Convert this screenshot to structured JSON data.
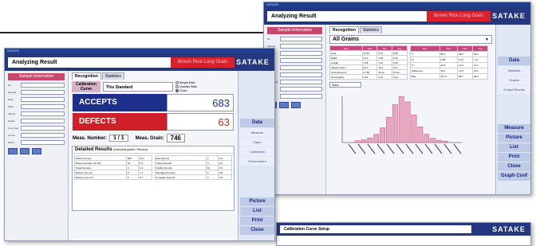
{
  "colors": {
    "header": "#24377f",
    "red": "#d8232a",
    "accepts": "#1d2f8a",
    "defects": "#cf1f2a",
    "pink": "#c9476a"
  },
  "win_back": {
    "titlebar": "SATAKE",
    "title": "Analyzing Result",
    "red_banner": "Brown Rice Long Grain",
    "brand": "SATAKE",
    "left_button": "Sample Information",
    "fields": [
      "No.",
      "Sample",
      "Date",
      "Place",
      "Variety",
      "Grade",
      "Crop Year",
      "Lot No.",
      "Memo"
    ],
    "tabs": [
      "Recognition",
      "Statistics"
    ],
    "combo": "All Grains",
    "table_left": {
      "headers": [
        "Item",
        "Max",
        "Min",
        "Avg"
      ],
      "rows": [
        [
          "Area",
          "12.45",
          "5.21",
          "8.95"
        ],
        [
          "Width",
          "3.10",
          "2.05",
          "2.63"
        ],
        [
          "Length",
          "7.85",
          "4.31",
          "6.42"
        ],
        [
          "Weight (Calc.)",
          "25.3",
          "10.4",
          "18.7"
        ],
        [
          "Circumference",
          "17.55",
          "11.02",
          "15.12"
        ],
        [
          "Chromaticity",
          "0.54",
          "0.31",
          "0.44"
        ]
      ]
    },
    "table_right": {
      "headers": [
        "Item",
        "Max",
        "Min",
        "Avg"
      ],
      "rows": [
        [
          "L*",
          "58.1",
          "48.2",
          "53.6"
        ],
        [
          "a*",
          "2.85",
          "0.12",
          "1.47"
        ],
        [
          "b*",
          "20.3",
          "14.5",
          "17.2"
        ],
        [
          "Whiteness",
          "18.2",
          "12.6",
          "15.4"
        ],
        [
          "Blue",
          "107.4",
          "89.7",
          "98.6"
        ]
      ]
    },
    "hist_select": "Area",
    "right_top": [
      "Data",
      "Statistics",
      "Graphs",
      "Output Results"
    ],
    "right_bottom": [
      "Measure",
      "Picture",
      "List",
      "Print",
      "Close",
      "Graph Conf"
    ]
  },
  "win_front": {
    "titlebar": "SATAKE",
    "title": "Analyzing Result",
    "red_banner": "Brown Rice Long Grain",
    "brand": "SATAKE",
    "left_button": "Sample Information",
    "fields": [
      "No.",
      "Sample",
      "Date",
      "Place",
      "Variety",
      "Grade",
      "Crop Year",
      "Lot No.",
      "Memo"
    ],
    "tabs": [
      "Recognition",
      "Statistics"
    ],
    "calib_label": "Calibration Curve",
    "calib_value": "This Standard",
    "radios": [
      "Weight Ratio",
      "Quantity Ratio",
      "Count"
    ],
    "accepts_label": "ACCEPTS",
    "accepts_value": "683",
    "defects_label": "DEFECTS",
    "defects_value": "63",
    "meas_number_label": "Meas. Number:",
    "meas_number_value": "1 / 1",
    "meas_grain_label": "Meas. Grain:",
    "meas_grain_value": "746",
    "detail_title": "Detailed Results",
    "detail_sub": "(Individual grains / Percent)",
    "detail_left": [
      [
        "Whole Kernels",
        "683",
        "91.6"
      ],
      [
        "Broken Kernels 1/2~3/4",
        "12",
        "1.6"
      ],
      [
        "Small Kernels",
        "9",
        "1.2"
      ],
      [
        "Broken 1/4~1/2",
        "8",
        "1.1"
      ],
      [
        "Broken Less 1/4",
        "5",
        "0.7"
      ]
    ],
    "detail_right": [
      [
        "Red Kernels",
        "2",
        "0.3"
      ],
      [
        "Yellow Kernels",
        "3",
        "0.4"
      ],
      [
        "Chalky Kernels",
        "14",
        "1.9"
      ],
      [
        "Damaged Kernels",
        "6",
        "0.8"
      ],
      [
        "Immature Kernels",
        "4",
        "0.5"
      ]
    ],
    "right_top": [
      "Data",
      "Measure",
      "Open",
      "Calibration",
      "Environment"
    ],
    "right_bottom": [
      "Picture",
      "List",
      "Print",
      "Close"
    ]
  },
  "win_bottom": {
    "title": "Calibration Curve Setup",
    "brand": "SATAKE"
  },
  "histogram": {
    "bars": [
      0.04,
      0.06,
      0.1,
      0.18,
      0.32,
      0.55,
      0.82,
      1.0,
      0.88,
      0.6,
      0.34,
      0.18,
      0.09,
      0.05,
      0.03
    ]
  }
}
